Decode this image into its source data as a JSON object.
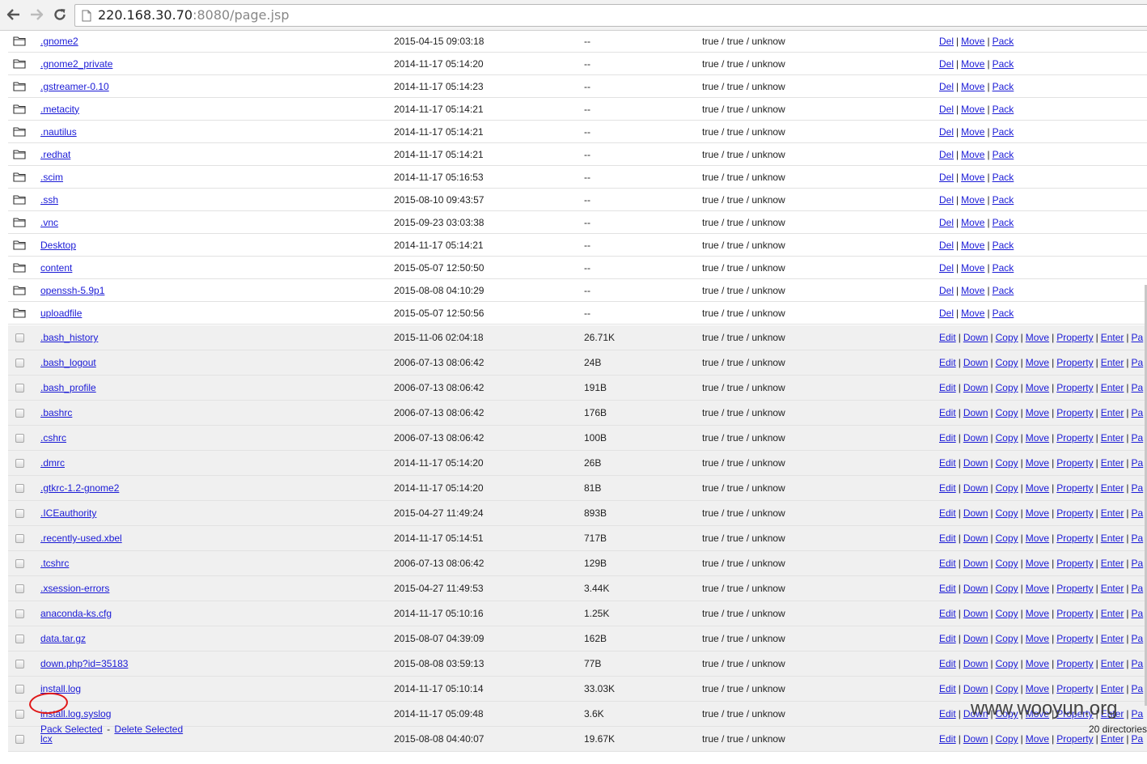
{
  "browser": {
    "url_host": "220.168.30.70",
    "url_rest": ":8080/page.jsp"
  },
  "directories": [
    {
      "name": ".gnome2",
      "time": "2015-04-15 09:03:18",
      "size": "--",
      "perm": "true / true / unknow"
    },
    {
      "name": ".gnome2_private",
      "time": "2014-11-17 05:14:20",
      "size": "--",
      "perm": "true / true / unknow"
    },
    {
      "name": ".gstreamer-0.10",
      "time": "2014-11-17 05:14:23",
      "size": "--",
      "perm": "true / true / unknow"
    },
    {
      "name": ".metacity",
      "time": "2014-11-17 05:14:21",
      "size": "--",
      "perm": "true / true / unknow"
    },
    {
      "name": ".nautilus",
      "time": "2014-11-17 05:14:21",
      "size": "--",
      "perm": "true / true / unknow"
    },
    {
      "name": ".redhat",
      "time": "2014-11-17 05:14:21",
      "size": "--",
      "perm": "true / true / unknow"
    },
    {
      "name": ".scim",
      "time": "2014-11-17 05:16:53",
      "size": "--",
      "perm": "true / true / unknow"
    },
    {
      "name": ".ssh",
      "time": "2015-08-10 09:43:57",
      "size": "--",
      "perm": "true / true / unknow"
    },
    {
      "name": ".vnc",
      "time": "2015-09-23 03:03:38",
      "size": "--",
      "perm": "true / true / unknow"
    },
    {
      "name": "Desktop",
      "time": "2014-11-17 05:14:21",
      "size": "--",
      "perm": "true / true / unknow"
    },
    {
      "name": "content",
      "time": "2015-05-07 12:50:50",
      "size": "--",
      "perm": "true / true / unknow"
    },
    {
      "name": "openssh-5.9p1",
      "time": "2015-08-08 04:10:29",
      "size": "--",
      "perm": "true / true / unknow"
    },
    {
      "name": "uploadfile",
      "time": "2015-05-07 12:50:56",
      "size": "--",
      "perm": "true / true / unknow"
    }
  ],
  "dir_actions": [
    "Del",
    "Move",
    "Pack"
  ],
  "files": [
    {
      "name": ".bash_history",
      "time": "2015-11-06 02:04:18",
      "size": "26.71K",
      "perm": "true / true / unknow"
    },
    {
      "name": ".bash_logout",
      "time": "2006-07-13 08:06:42",
      "size": "24B",
      "perm": "true / true / unknow"
    },
    {
      "name": ".bash_profile",
      "time": "2006-07-13 08:06:42",
      "size": "191B",
      "perm": "true / true / unknow"
    },
    {
      "name": ".bashrc",
      "time": "2006-07-13 08:06:42",
      "size": "176B",
      "perm": "true / true / unknow"
    },
    {
      "name": ".cshrc",
      "time": "2006-07-13 08:06:42",
      "size": "100B",
      "perm": "true / true / unknow"
    },
    {
      "name": ".dmrc",
      "time": "2014-11-17 05:14:20",
      "size": "26B",
      "perm": "true / true / unknow"
    },
    {
      "name": ".gtkrc-1.2-gnome2",
      "time": "2014-11-17 05:14:20",
      "size": "81B",
      "perm": "true / true / unknow"
    },
    {
      "name": ".ICEauthority",
      "time": "2015-04-27 11:49:24",
      "size": "893B",
      "perm": "true / true / unknow"
    },
    {
      "name": ".recently-used.xbel",
      "time": "2014-11-17 05:14:51",
      "size": "717B",
      "perm": "true / true / unknow"
    },
    {
      "name": ".tcshrc",
      "time": "2006-07-13 08:06:42",
      "size": "129B",
      "perm": "true / true / unknow"
    },
    {
      "name": ".xsession-errors",
      "time": "2015-04-27 11:49:53",
      "size": "3.44K",
      "perm": "true / true / unknow"
    },
    {
      "name": "anaconda-ks.cfg",
      "time": "2014-11-17 05:10:16",
      "size": "1.25K",
      "perm": "true / true / unknow"
    },
    {
      "name": "data.tar.gz",
      "time": "2015-08-07 04:39:09",
      "size": "162B",
      "perm": "true / true / unknow"
    },
    {
      "name": "down.php?id=35183",
      "time": "2015-08-08 03:59:13",
      "size": "77B",
      "perm": "true / true / unknow"
    },
    {
      "name": "install.log",
      "time": "2014-11-17 05:10:14",
      "size": "33.03K",
      "perm": "true / true / unknow"
    },
    {
      "name": "install.log.syslog",
      "time": "2014-11-17 05:09:48",
      "size": "3.6K",
      "perm": "true / true / unknow"
    },
    {
      "name": "lcx",
      "time": "2015-08-08 04:40:07",
      "size": "19.67K",
      "perm": "true / true / unknow"
    }
  ],
  "file_actions": [
    "Edit",
    "Down",
    "Copy",
    "Move",
    "Property",
    "Enter",
    "Pa"
  ],
  "footer": {
    "pack_selected": "Pack Selected",
    "dash": "-",
    "delete_selected": "Delete Selected",
    "summary": "20 directories"
  },
  "watermark": "www.wooyun.org"
}
